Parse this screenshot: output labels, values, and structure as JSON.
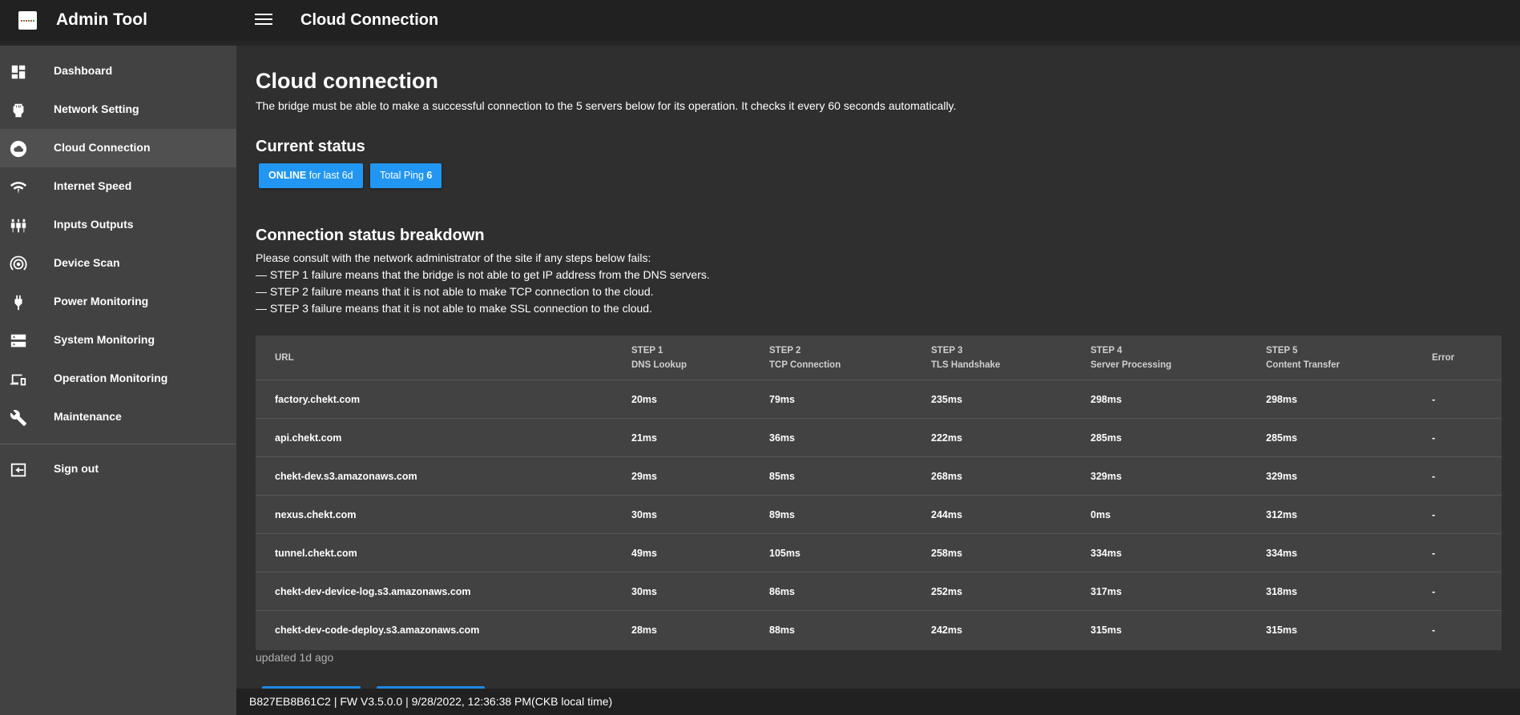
{
  "app": {
    "title": "Admin Tool",
    "page_heading": "Cloud Connection"
  },
  "sidebar": {
    "items": [
      {
        "label": "Dashboard",
        "icon": "dashboard-icon"
      },
      {
        "label": "Network Setting",
        "icon": "ethernet-icon"
      },
      {
        "label": "Cloud Connection",
        "icon": "cloud-icon",
        "active": true
      },
      {
        "label": "Internet Speed",
        "icon": "wifi-icon"
      },
      {
        "label": "Inputs Outputs",
        "icon": "io-icon"
      },
      {
        "label": "Device Scan",
        "icon": "radar-icon"
      },
      {
        "label": "Power Monitoring",
        "icon": "plug-icon"
      },
      {
        "label": "System Monitoring",
        "icon": "server-icon"
      },
      {
        "label": "Operation Monitoring",
        "icon": "devices-icon"
      },
      {
        "label": "Maintenance",
        "icon": "wrench-icon"
      }
    ],
    "signout": {
      "label": "Sign out",
      "icon": "signout-icon"
    }
  },
  "main": {
    "title": "Cloud connection",
    "intro": "The bridge must be able to make a successful connection to the 5 servers below for its operation. It checks it every 60 seconds automatically.",
    "current_status": {
      "heading": "Current status",
      "online_strong": "ONLINE",
      "online_rest": " for last 6d",
      "ping_label": "Total Ping ",
      "ping_value": "6"
    },
    "breakdown": {
      "heading": "Connection status breakdown",
      "lines": [
        "Please consult with the network administrator of the site if any steps below fails:",
        "— STEP 1 failure means that the bridge is not able to get IP address from the DNS servers.",
        "— STEP 2 failure means that it is not able to make TCP connection to the cloud.",
        "— STEP 3 failure means that it is not able to make SSL connection to the cloud."
      ]
    },
    "table": {
      "headers": [
        {
          "top": "URL",
          "bottom": ""
        },
        {
          "top": "STEP 1",
          "bottom": "DNS Lookup"
        },
        {
          "top": "STEP 2",
          "bottom": "TCP Connection"
        },
        {
          "top": "STEP 3",
          "bottom": "TLS Handshake"
        },
        {
          "top": "STEP 4",
          "bottom": "Server Processing"
        },
        {
          "top": "STEP 5",
          "bottom": "Content Transfer"
        },
        {
          "top": "Error",
          "bottom": ""
        }
      ],
      "rows": [
        [
          "factory.chekt.com",
          "20ms",
          "79ms",
          "235ms",
          "298ms",
          "298ms",
          "-"
        ],
        [
          "api.chekt.com",
          "21ms",
          "36ms",
          "222ms",
          "285ms",
          "285ms",
          "-"
        ],
        [
          "chekt-dev.s3.amazonaws.com",
          "29ms",
          "85ms",
          "268ms",
          "329ms",
          "329ms",
          "-"
        ],
        [
          "nexus.chekt.com",
          "30ms",
          "89ms",
          "244ms",
          "0ms",
          "312ms",
          "-"
        ],
        [
          "tunnel.chekt.com",
          "49ms",
          "105ms",
          "258ms",
          "334ms",
          "334ms",
          "-"
        ],
        [
          "chekt-dev-device-log.s3.amazonaws.com",
          "30ms",
          "86ms",
          "252ms",
          "317ms",
          "318ms",
          "-"
        ],
        [
          "chekt-dev-code-deploy.s3.amazonaws.com",
          "28ms",
          "88ms",
          "242ms",
          "315ms",
          "315ms",
          "-"
        ]
      ]
    },
    "updated": "updated 1d ago"
  },
  "footer": {
    "text": "B827EB8B61C2 | FW V3.5.0.0 | 9/28/2022, 12:36:38 PM(CKB local time)"
  },
  "colors": {
    "accent": "#2196f3",
    "sidebar": "#424242",
    "appbar": "#212121",
    "background": "#2f2f2f"
  }
}
